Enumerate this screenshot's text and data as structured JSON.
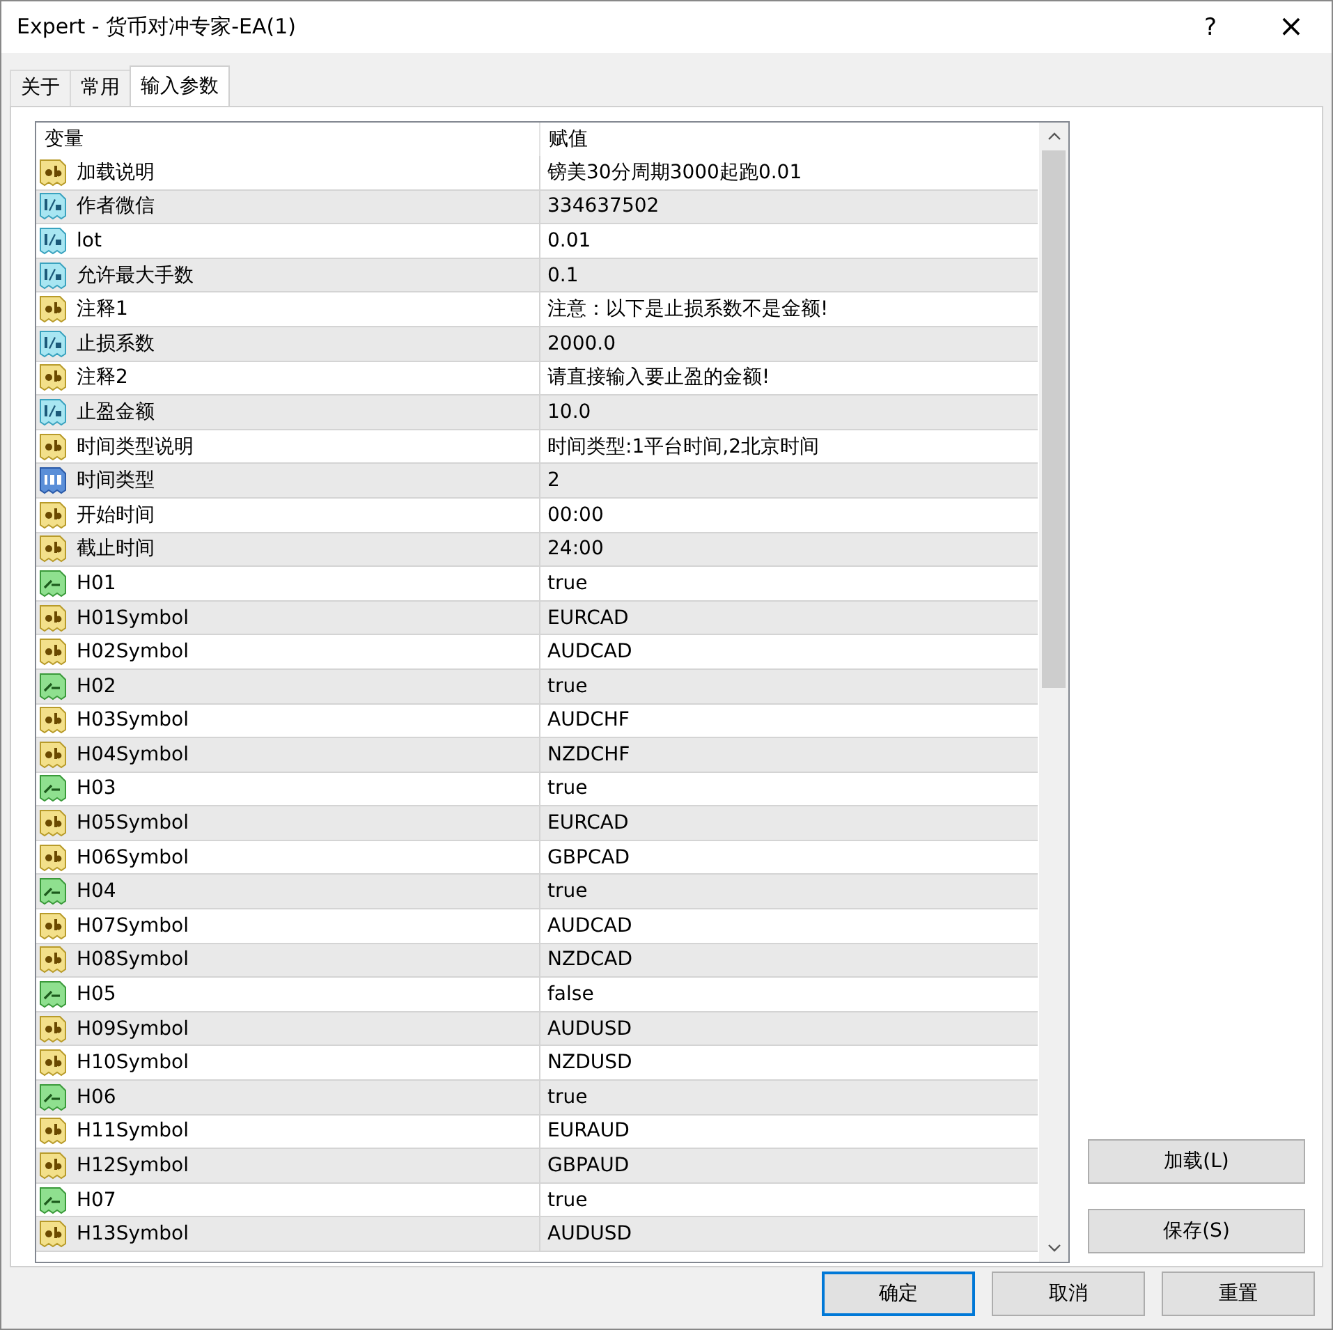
{
  "window": {
    "title": "Expert - 货币对冲专家-EA(1)",
    "help": "?",
    "close": "×"
  },
  "tabs": [
    {
      "label": "关于",
      "selected": false
    },
    {
      "label": "常用",
      "selected": false
    },
    {
      "label": "输入参数",
      "selected": true
    }
  ],
  "table": {
    "columns": [
      "变量",
      "赋值"
    ],
    "rows": [
      {
        "kind": "string",
        "name": "加载说明",
        "value": "镑美30分周期3000起跑0.01"
      },
      {
        "kind": "double",
        "name": "作者微信",
        "value": "334637502"
      },
      {
        "kind": "double",
        "name": "lot",
        "value": "0.01"
      },
      {
        "kind": "double",
        "name": "允许最大手数",
        "value": "0.1"
      },
      {
        "kind": "string",
        "name": "注释1",
        "value": "注意：以下是止损系数不是金额!"
      },
      {
        "kind": "double",
        "name": "止损系数",
        "value": "2000.0"
      },
      {
        "kind": "string",
        "name": "注释2",
        "value": "请直接输入要止盈的金额!"
      },
      {
        "kind": "double",
        "name": "止盈金额",
        "value": "10.0"
      },
      {
        "kind": "string",
        "name": "时间类型说明",
        "value": "时间类型:1平台时间,2北京时间"
      },
      {
        "kind": "int",
        "name": "时间类型",
        "value": "2"
      },
      {
        "kind": "string",
        "name": "开始时间",
        "value": "00:00"
      },
      {
        "kind": "string",
        "name": "截止时间",
        "value": "24:00"
      },
      {
        "kind": "bool",
        "name": "H01",
        "value": "true"
      },
      {
        "kind": "string",
        "name": "H01Symbol",
        "value": "EURCAD"
      },
      {
        "kind": "string",
        "name": "H02Symbol",
        "value": "AUDCAD"
      },
      {
        "kind": "bool",
        "name": "H02",
        "value": "true"
      },
      {
        "kind": "string",
        "name": "H03Symbol",
        "value": "AUDCHF"
      },
      {
        "kind": "string",
        "name": "H04Symbol",
        "value": "NZDCHF"
      },
      {
        "kind": "bool",
        "name": "H03",
        "value": "true"
      },
      {
        "kind": "string",
        "name": "H05Symbol",
        "value": "EURCAD"
      },
      {
        "kind": "string",
        "name": "H06Symbol",
        "value": "GBPCAD"
      },
      {
        "kind": "bool",
        "name": "H04",
        "value": "true"
      },
      {
        "kind": "string",
        "name": "H07Symbol",
        "value": "AUDCAD"
      },
      {
        "kind": "string",
        "name": "H08Symbol",
        "value": "NZDCAD"
      },
      {
        "kind": "bool",
        "name": "H05",
        "value": "false"
      },
      {
        "kind": "string",
        "name": "H09Symbol",
        "value": "AUDUSD"
      },
      {
        "kind": "string",
        "name": "H10Symbol",
        "value": "NZDUSD"
      },
      {
        "kind": "bool",
        "name": "H06",
        "value": "true"
      },
      {
        "kind": "string",
        "name": "H11Symbol",
        "value": "EURAUD"
      },
      {
        "kind": "string",
        "name": "H12Symbol",
        "value": "GBPAUD"
      },
      {
        "kind": "bool",
        "name": "H07",
        "value": "true"
      },
      {
        "kind": "string",
        "name": "H13Symbol",
        "value": "AUDUSD"
      }
    ]
  },
  "side_buttons": [
    "加载(L)",
    "保存(S)"
  ],
  "buttons": [
    {
      "label": "确定",
      "kind": "default"
    },
    {
      "label": "取消",
      "kind": "normal"
    },
    {
      "label": "重置",
      "kind": "normal"
    }
  ]
}
